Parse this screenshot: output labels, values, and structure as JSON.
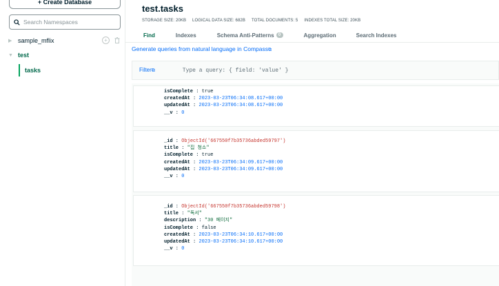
{
  "sidebar": {
    "create_db_label": "+ Create Database",
    "search_placeholder": "Search Namespaces",
    "databases": [
      {
        "name": "sample_mflix"
      },
      {
        "name": "test"
      }
    ],
    "collection": "tasks"
  },
  "header": {
    "title": "test.tasks",
    "stats": [
      "STORAGE SIZE: 20KB",
      "LOGICAL DATA SIZE: 682B",
      "TOTAL DOCUMENTS: 5",
      "INDEXES TOTAL SIZE: 20KB"
    ]
  },
  "tabs": [
    {
      "label": "Find"
    },
    {
      "label": "Indexes"
    },
    {
      "label": "Schema Anti-Patterns",
      "badge": "0"
    },
    {
      "label": "Aggregation"
    },
    {
      "label": "Search Indexes"
    }
  ],
  "generate_link": "Generate queries from natural language in Compass",
  "filter": {
    "label": "Filter",
    "placeholder": "Type a query: { field: 'value' }"
  },
  "documents": [
    [
      {
        "key": "isComplete",
        "value": "true",
        "type": "bool"
      },
      {
        "key": "createdAt",
        "value": "2023-03-23T06:34:08.617+00:00",
        "type": "date"
      },
      {
        "key": "updatedAt",
        "value": "2023-03-23T06:34:08.617+00:00",
        "type": "date"
      },
      {
        "key": "__v",
        "value": "0",
        "type": "num"
      }
    ],
    [
      {
        "key": "_id",
        "value": "ObjectId('667550f7b35736abded59797')",
        "type": "oid"
      },
      {
        "key": "title",
        "value": "\"집 청소\"",
        "type": "str"
      },
      {
        "key": "isComplete",
        "value": "true",
        "type": "bool"
      },
      {
        "key": "createdAt",
        "value": "2023-03-23T06:34:09.617+00:00",
        "type": "date"
      },
      {
        "key": "updatedAt",
        "value": "2023-03-23T06:34:09.617+00:00",
        "type": "date"
      },
      {
        "key": "__v",
        "value": "0",
        "type": "num"
      }
    ],
    [
      {
        "key": "_id",
        "value": "ObjectId('667550f7b35736abded59798')",
        "type": "oid"
      },
      {
        "key": "title",
        "value": "\"독서\"",
        "type": "str"
      },
      {
        "key": "description",
        "value": "\"30 페이지\"",
        "type": "str"
      },
      {
        "key": "isComplete",
        "value": "false",
        "type": "bool"
      },
      {
        "key": "createdAt",
        "value": "2023-03-23T06:34:10.617+00:00",
        "type": "date"
      },
      {
        "key": "updatedAt",
        "value": "2023-03-23T06:34:10.617+00:00",
        "type": "date"
      },
      {
        "key": "__v",
        "value": "0",
        "type": "num"
      }
    ]
  ]
}
